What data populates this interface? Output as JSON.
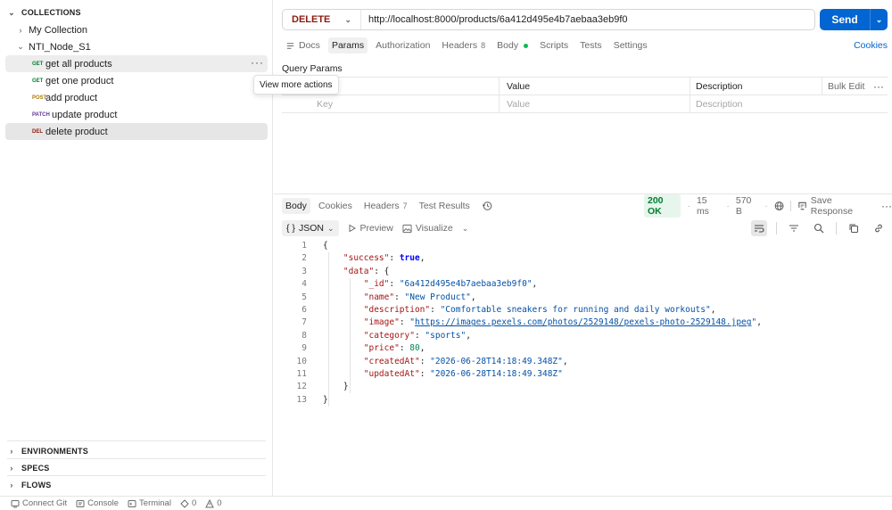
{
  "sidebar": {
    "collections_header": "COLLECTIONS",
    "my_collection": "My Collection",
    "folder": "NTI_Node_S1",
    "requests": [
      {
        "method": "GET",
        "label": "get all products"
      },
      {
        "method": "GET",
        "label": "get one product"
      },
      {
        "method": "POST",
        "label": "add product"
      },
      {
        "method": "PATCH",
        "label": "update product"
      },
      {
        "method": "DEL",
        "label": "delete product"
      }
    ],
    "tooltip": "View more actions",
    "bottom_sections": [
      "ENVIRONMENTS",
      "SPECS",
      "FLOWS"
    ]
  },
  "request": {
    "method": "DELETE",
    "url": "http://localhost:8000/products/6a412d495e4b7aebaa3eb9f0",
    "send_label": "Send",
    "tabs": {
      "docs": "Docs",
      "params": "Params",
      "authorization": "Authorization",
      "headers": "Headers",
      "headers_count": "8",
      "body": "Body",
      "scripts": "Scripts",
      "tests": "Tests",
      "settings": "Settings"
    },
    "cookies_link": "Cookies",
    "query_params": {
      "title": "Query Params",
      "headers": {
        "value": "Value",
        "description": "Description"
      },
      "bulk_edit": "Bulk Edit",
      "placeholders": {
        "key": "Key",
        "value": "Value",
        "description": "Description"
      }
    }
  },
  "response": {
    "tabs": {
      "body": "Body",
      "cookies": "Cookies",
      "headers": "Headers",
      "headers_count": "7",
      "test_results": "Test Results"
    },
    "status": "200 OK",
    "time": "15 ms",
    "size": "570 B",
    "save_response": "Save Response",
    "format": "JSON",
    "preview": "Preview",
    "visualize": "Visualize",
    "json": {
      "success": "true",
      "id": "\"6a412d495e4b7aebaa3eb9f0\"",
      "name": "\"New Product\"",
      "description": "\"Comfortable sneakers for running and daily workouts\"",
      "image": "https://images.pexels.com/photos/2529148/pexels-photo-2529148.jpeg",
      "category": "\"sports\"",
      "price": "80",
      "createdAt": "\"2026-06-28T14:18:49.348Z\"",
      "updatedAt": "\"2026-06-28T14:18:49.348Z\""
    },
    "line_numbers": [
      "1",
      "2",
      "3",
      "4",
      "5",
      "6",
      "7",
      "8",
      "9",
      "10",
      "11",
      "12",
      "13"
    ]
  },
  "statusbar": {
    "connect_git": "Connect Git",
    "console": "Console",
    "terminal": "Terminal",
    "errors": "0",
    "warnings": "0"
  },
  "colors": {
    "send_button": "#0265d2",
    "delete_method": "#8e1a10",
    "get_method": "#007f31",
    "post_method": "#ad7a03",
    "patch_method": "#623497",
    "status_ok": "#007f31"
  }
}
